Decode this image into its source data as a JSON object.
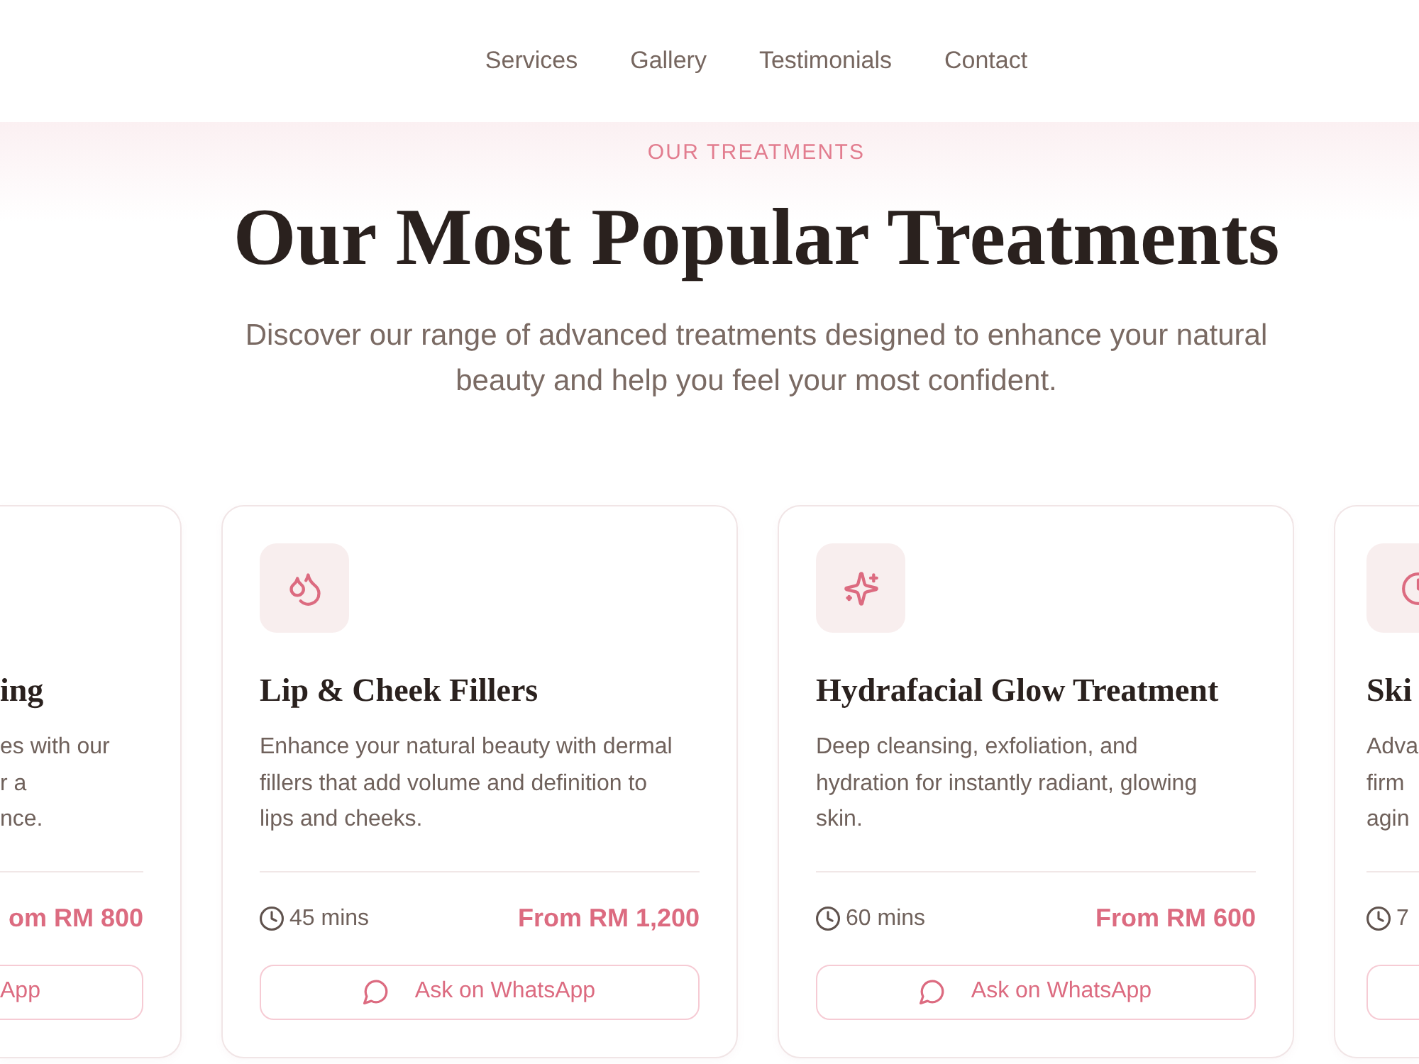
{
  "nav": {
    "links": [
      "Services",
      "Gallery",
      "Testimonials",
      "Contact"
    ]
  },
  "intro": {
    "eyebrow": "OUR TREATMENTS",
    "title": "Our Most Popular Treatments",
    "text": "Discover our range of advanced treatments designed to enhance your natural beauty and help you feel your most confident."
  },
  "treatments": [
    {
      "kind": "cut_left",
      "title": "ing",
      "description_lines": [
        "es with our",
        "r a",
        "nce."
      ],
      "price": "om RM 800",
      "button": "App"
    },
    {
      "kind": "full",
      "title": "Lip & Cheek Fillers",
      "description": "Enhance your natural beauty with dermal fillers that add volume and definition to lips and cheeks.",
      "duration": "45 mins",
      "price": "From RM 1,200",
      "button": "Ask on WhatsApp"
    },
    {
      "kind": "full",
      "title": "Hydrafacial Glow Treatment",
      "description": "Deep cleansing, exfoliation, and hydration for instantly radiant, glowing skin.",
      "duration": "60 mins",
      "price": "From RM 600",
      "button": "Ask on WhatsApp"
    },
    {
      "kind": "cut_right",
      "title": "Ski",
      "description_lines": [
        "Adva",
        "firm",
        "agin"
      ],
      "duration": "7"
    }
  ]
}
